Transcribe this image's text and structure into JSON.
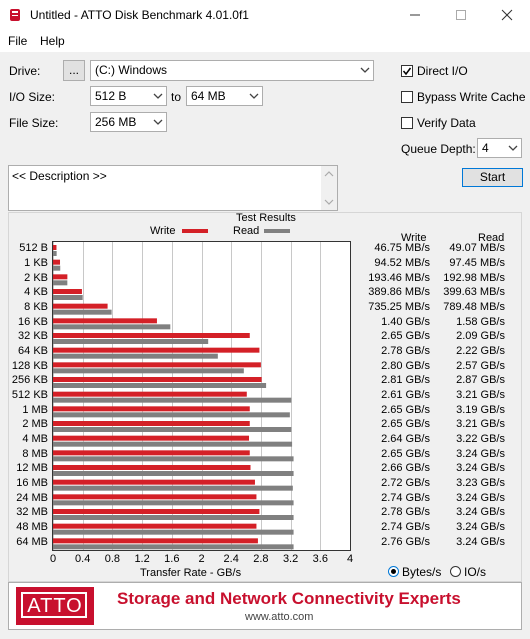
{
  "window": {
    "title": "Untitled - ATTO Disk Benchmark 4.01.0f1"
  },
  "menu": [
    "File",
    "Help"
  ],
  "controls": {
    "drive_label": "Drive:",
    "drive_browse": "...",
    "drive_value": "(C:) Windows",
    "io_size_label": "I/O Size:",
    "io_from": "512 B",
    "io_to_label": "to",
    "io_to": "64 MB",
    "file_size_label": "File Size:",
    "file_size": "256 MB",
    "direct_io_label": "Direct I/O",
    "direct_io": true,
    "bypass_write_cache_label": "Bypass Write Cache",
    "bypass_write_cache": false,
    "verify_data_label": "Verify Data",
    "verify_data": false,
    "queue_depth_label": "Queue Depth:",
    "queue_depth": "4",
    "start_label": "Start",
    "description": "<< Description >>"
  },
  "results": {
    "title": "Test Results",
    "legend_write": "Write",
    "legend_read": "Read",
    "write_col": "Write",
    "read_col": "Read",
    "write_color": "#d42027",
    "read_color": "#808080",
    "units_bytes": "Bytes/s",
    "units_io": "IO/s",
    "units_selected": "Bytes/s"
  },
  "chart_data": {
    "type": "bar",
    "xlabel": "Transfer Rate - GB/s",
    "xlim": [
      0,
      4
    ],
    "xticks": [
      "0",
      "0.4",
      "0.8",
      "1.2",
      "1.6",
      "2",
      "2.4",
      "2.8",
      "3.2",
      "3.6",
      "4"
    ],
    "categories": [
      "512 B",
      "1 KB",
      "2 KB",
      "4 KB",
      "8 KB",
      "16 KB",
      "32 KB",
      "64 KB",
      "128 KB",
      "256 KB",
      "512 KB",
      "1 MB",
      "2 MB",
      "4 MB",
      "8 MB",
      "12 MB",
      "16 MB",
      "24 MB",
      "32 MB",
      "48 MB",
      "64 MB"
    ],
    "series": [
      {
        "name": "Write",
        "values": [
          0.04675,
          0.09452,
          0.19346,
          0.38986,
          0.73525,
          1.4,
          2.65,
          2.78,
          2.8,
          2.81,
          2.61,
          2.65,
          2.65,
          2.64,
          2.65,
          2.66,
          2.72,
          2.74,
          2.78,
          2.74,
          2.76
        ]
      },
      {
        "name": "Read",
        "values": [
          0.04907,
          0.09745,
          0.19298,
          0.39963,
          0.78948,
          1.58,
          2.09,
          2.22,
          2.57,
          2.87,
          3.21,
          3.19,
          3.21,
          3.22,
          3.24,
          3.24,
          3.23,
          3.24,
          3.24,
          3.24,
          3.24
        ]
      }
    ],
    "write_text": [
      "46.75 MB/s",
      "94.52 MB/s",
      "193.46 MB/s",
      "389.86 MB/s",
      "735.25 MB/s",
      "1.40 GB/s",
      "2.65 GB/s",
      "2.78 GB/s",
      "2.80 GB/s",
      "2.81 GB/s",
      "2.61 GB/s",
      "2.65 GB/s",
      "2.65 GB/s",
      "2.64 GB/s",
      "2.65 GB/s",
      "2.66 GB/s",
      "2.72 GB/s",
      "2.74 GB/s",
      "2.78 GB/s",
      "2.74 GB/s",
      "2.76 GB/s"
    ],
    "read_text": [
      "49.07 MB/s",
      "97.45 MB/s",
      "192.98 MB/s",
      "399.63 MB/s",
      "789.48 MB/s",
      "1.58 GB/s",
      "2.09 GB/s",
      "2.22 GB/s",
      "2.57 GB/s",
      "2.87 GB/s",
      "3.21 GB/s",
      "3.19 GB/s",
      "3.21 GB/s",
      "3.22 GB/s",
      "3.24 GB/s",
      "3.24 GB/s",
      "3.23 GB/s",
      "3.24 GB/s",
      "3.24 GB/s",
      "3.24 GB/s",
      "3.24 GB/s"
    ]
  },
  "banner": {
    "logo": "ATTO",
    "tagline": "Storage and Network Connectivity Experts",
    "url": "www.atto.com"
  }
}
